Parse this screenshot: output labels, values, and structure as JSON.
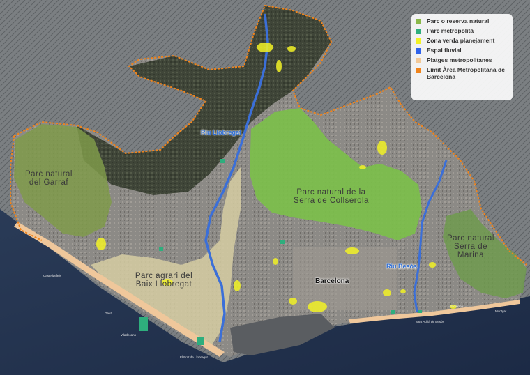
{
  "map": {
    "legend": [
      {
        "label": "Parc o reserva natural",
        "color": "#8ab84a"
      },
      {
        "label": "Parc metropolità",
        "color": "#2eae7d"
      },
      {
        "label": "Zona verda planejament",
        "color": "#f2f226"
      },
      {
        "label": "Espai fluvial",
        "color": "#2f63ec"
      },
      {
        "label": "Platges metropolitanes",
        "color": "#f3c998"
      },
      {
        "label": "Límit Àrea Metropolitana de Barcelona",
        "color": "#f0841c"
      }
    ],
    "parks": {
      "garraf": "Parc natural del Garraf",
      "collserola": "Parc natural de la Serra de Collserola",
      "marina": "Parc natural Serra de Marina",
      "baix_llobregat": "Parc agrari del Baix Llobregat"
    },
    "rivers": {
      "llobregat": "Riu Llobregat",
      "besos": "Riu Besòs"
    },
    "city": "Barcelona",
    "small_labels": {
      "castelldefels": "Castelldefels",
      "gava": "Gavà",
      "viladecans": "Viladecans",
      "el_prat": "El Prat de Llobregat",
      "sant_adria": "Sant Adrià de Besòs",
      "badalona": "Badalona",
      "montgat": "Montgat"
    }
  }
}
